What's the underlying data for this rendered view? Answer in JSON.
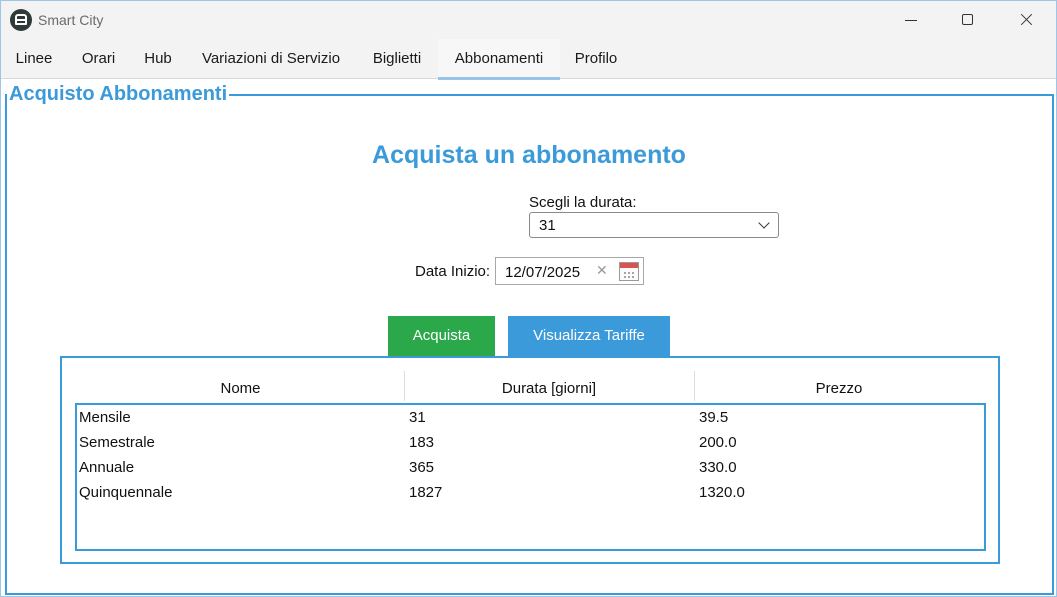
{
  "window": {
    "title": "Smart City"
  },
  "tabs": [
    "Linee",
    "Orari",
    "Hub",
    "Variazioni di Servizio",
    "Biglietti",
    "Abbonamenti",
    "Profilo"
  ],
  "active_tab": "Abbonamenti",
  "panel": {
    "legend": "Acquisto Abbonamenti",
    "heading": "Acquista un abbonamento",
    "duration_label": "Scegli la durata:",
    "duration_value": "31",
    "date_label": "Data Inizio:",
    "date_value": "12/07/2025",
    "buy_button": "Acquista",
    "rates_button": "Visualizza Tariffe"
  },
  "table": {
    "headers": [
      "Nome",
      "Durata [giorni]",
      "Prezzo"
    ],
    "rows": [
      [
        "Mensile",
        "31",
        "39.5"
      ],
      [
        "Semestrale",
        "183",
        "200.0"
      ],
      [
        "Annuale",
        "365",
        "330.0"
      ],
      [
        "Quinquennale",
        "1827",
        "1320.0"
      ]
    ]
  },
  "colors": {
    "accent": "#3b9ad9",
    "buy": "#2aa84a"
  }
}
